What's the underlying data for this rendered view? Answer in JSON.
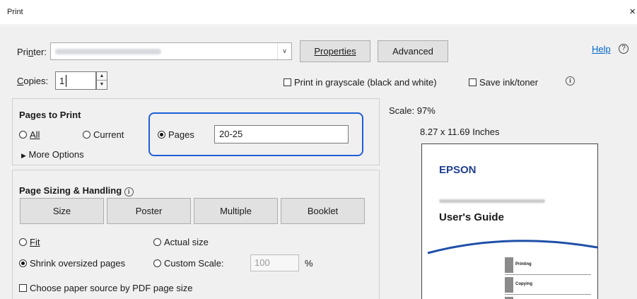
{
  "window": {
    "title": "Print",
    "close_glyph": "×"
  },
  "printer": {
    "label_u": "n",
    "label_rest_before": "Pri",
    "label_rest_after": "ter:",
    "properties_label": "Properties",
    "advanced_label": "Advanced",
    "help_label": "Help"
  },
  "copies": {
    "label_u": "C",
    "label_rest": "opies:",
    "value": "1"
  },
  "grayscale": {
    "label": "Print in grayscale (black and white)"
  },
  "save_ink": {
    "label": "Save ink/toner"
  },
  "pages_to_print": {
    "heading": "Pages to Print",
    "all_label": "All",
    "current_label": "Current",
    "pages_label": "Pages",
    "pages_value": "20-25",
    "more_options_label": "More Options"
  },
  "page_sizing": {
    "heading": "Page Sizing & Handling",
    "tabs": [
      "Size",
      "Poster",
      "Multiple",
      "Booklet"
    ],
    "fit_label": "Fit",
    "actual_size_label": "Actual size",
    "shrink_label": "Shrink oversized pages",
    "custom_scale_label": "Custom Scale:",
    "custom_scale_value": "100",
    "percent": "%",
    "paper_source_label": "Choose paper source by PDF page size"
  },
  "preview": {
    "scale_label": "Scale:",
    "scale_value": "97%",
    "dimensions": "8.27 x 11.69 Inches",
    "brand": "EPSON",
    "doc_title": "User's Guide",
    "tab_labels": [
      "Printing",
      "Copying"
    ]
  },
  "colors": {
    "highlight": "#1f5fd6",
    "epson_blue": "#1f3f8f"
  }
}
